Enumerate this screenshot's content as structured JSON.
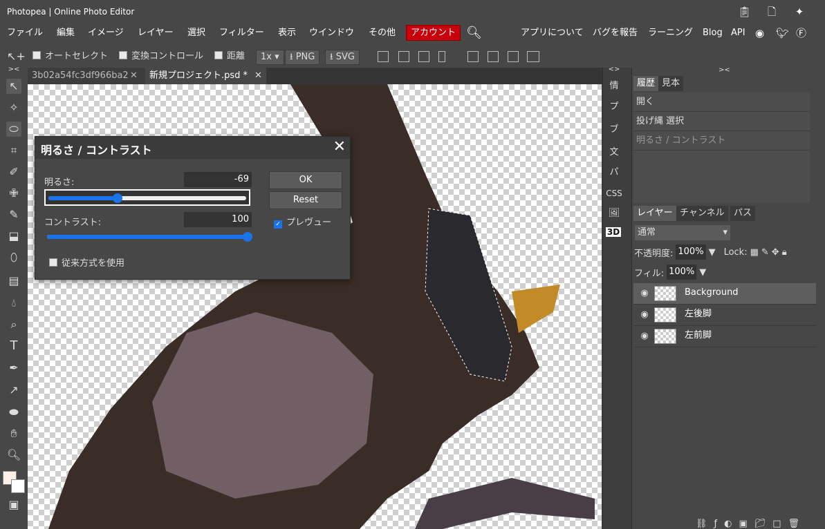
{
  "app": {
    "title": "Photopea | Online Photo Editor"
  },
  "menu": {
    "items": [
      "ファイル",
      "編集",
      "イメージ",
      "レイヤー",
      "選択",
      "フィルター",
      "表示",
      "ウインドウ",
      "その他"
    ],
    "account": "アカウント",
    "right_items": [
      "アプリについて",
      "バグを報告",
      "ラーニング",
      "Blog",
      "API"
    ]
  },
  "options": {
    "autoselect": "オートセレクト",
    "transform": "変換コントロール",
    "distance": "距離",
    "zoom": "1x",
    "png": "PNG",
    "svg": "SVG"
  },
  "tabs": [
    {
      "label": "3b02a54fc3df966ba2",
      "active": false
    },
    {
      "label": "新規プロジェクト.psd *",
      "active": true
    }
  ],
  "mini_panel": [
    "情",
    "プ",
    "ブ",
    "文",
    "パ",
    "CSS",
    "3D"
  ],
  "right_panel": {
    "history_tabs": [
      "履歴",
      "見本"
    ],
    "history": [
      "開く",
      "投げ縄 選択",
      "明るさ / コントラスト"
    ],
    "layer_tabs": [
      "レイヤー",
      "チャンネル",
      "パス"
    ],
    "blend_mode": "通常",
    "opacity_label": "不透明度:",
    "opacity_value": "100%",
    "lock_label": "Lock:",
    "fill_label": "フィル:",
    "fill_value": "100%",
    "layers": [
      {
        "name": "Background",
        "selected": true
      },
      {
        "name": "左後脚",
        "selected": false
      },
      {
        "name": "左前脚",
        "selected": false
      }
    ]
  },
  "dialog": {
    "title": "明るさ / コントラスト",
    "brightness_label": "明るさ:",
    "brightness_value": "-69",
    "contrast_label": "コントラスト:",
    "contrast_value": "100",
    "ok": "OK",
    "reset": "Reset",
    "preview_label": "プレヴュー",
    "preview_checked": true,
    "legacy_label": "従来方式を使用",
    "legacy_checked": false,
    "brightness_fraction": 0.35,
    "contrast_fraction": 1.0
  },
  "colors": {
    "accent": "#1a73e8",
    "account_bg": "#c7000c",
    "panel_bg": "#474747"
  }
}
